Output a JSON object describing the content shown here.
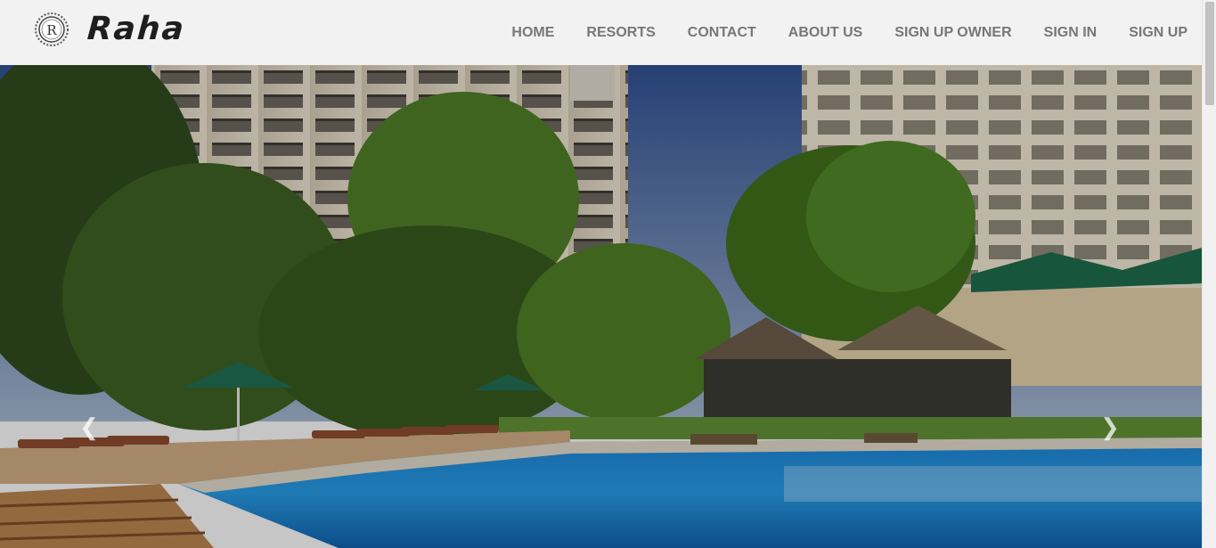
{
  "brand": {
    "logo_letter": "R",
    "name": "Raha",
    "logo_icon": "seal-logo-icon"
  },
  "nav": {
    "items": [
      {
        "label": "HOME"
      },
      {
        "label": "RESORTS"
      },
      {
        "label": "CONTACT"
      },
      {
        "label": "ABOUT US"
      },
      {
        "label": "SIGN UP OWNER"
      },
      {
        "label": "SIGN IN"
      },
      {
        "label": "SIGN UP"
      }
    ]
  },
  "carousel": {
    "prev_icon": "chevron-left-icon",
    "next_icon": "chevron-right-icon",
    "prev_glyph": "❮",
    "next_glyph": "❯"
  },
  "colors": {
    "header_bg": "#f2f2f2",
    "nav_text": "#777777",
    "brand_text": "#1e1e1e",
    "pool": "#1e8fd6",
    "sky": "#3f5f99"
  }
}
